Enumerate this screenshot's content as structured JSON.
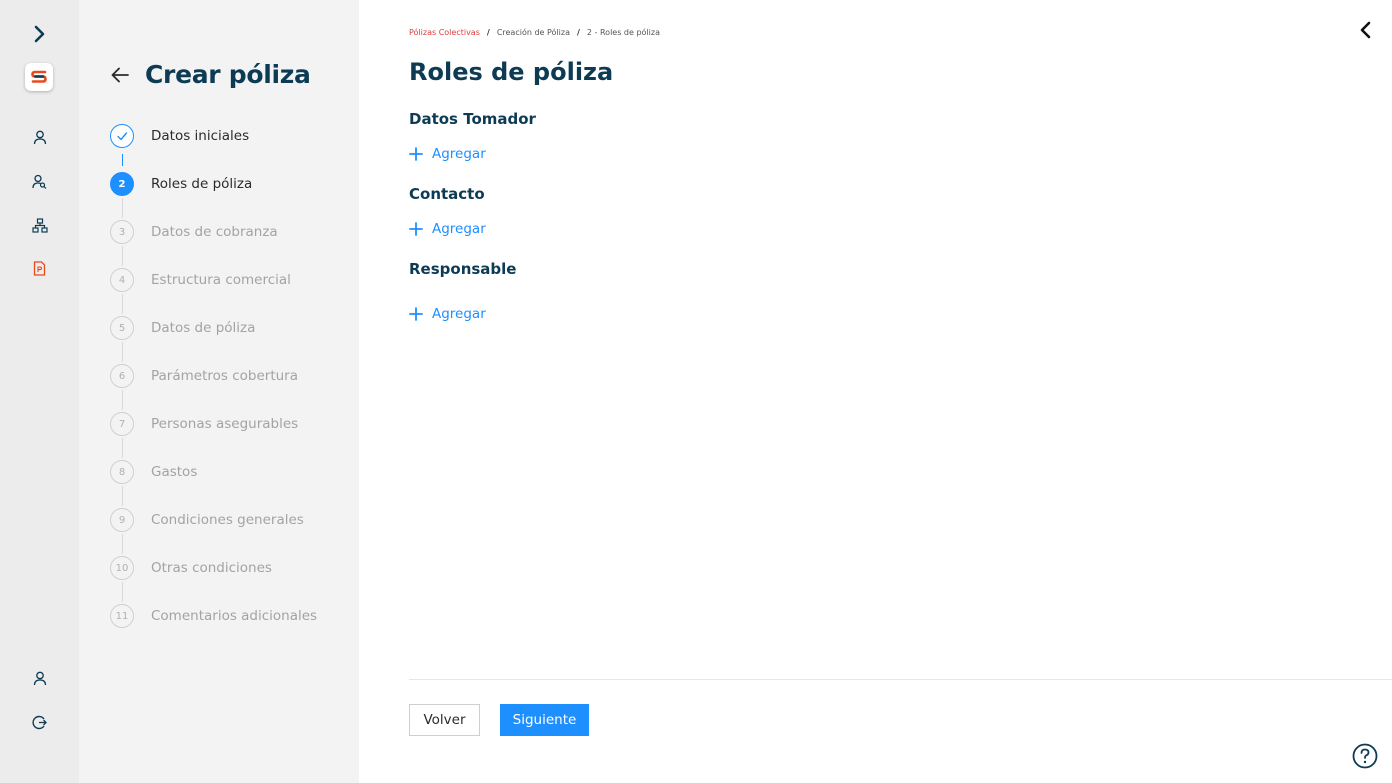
{
  "app": {
    "title": "Crear póliza"
  },
  "colors": {
    "accent": "#1e8fff",
    "brand_dark": "#0d3b54",
    "brand_red": "#e84a1e"
  },
  "rail": {
    "items": [
      {
        "icon": "chevron-right-icon"
      },
      {
        "icon": "logo-icon"
      },
      {
        "icon": "user-icon"
      },
      {
        "icon": "users-search-icon"
      },
      {
        "icon": "hierarchy-icon"
      },
      {
        "icon": "policy-document-icon"
      },
      {
        "icon": "profile-icon"
      },
      {
        "icon": "logout-icon"
      }
    ]
  },
  "steps": {
    "title": "Crear póliza",
    "items": [
      {
        "num": "1",
        "label": "Datos iniciales",
        "state": "done"
      },
      {
        "num": "2",
        "label": "Roles de póliza",
        "state": "active"
      },
      {
        "num": "3",
        "label": "Datos de cobranza",
        "state": "pending"
      },
      {
        "num": "4",
        "label": "Estructura comercial",
        "state": "pending"
      },
      {
        "num": "5",
        "label": "Datos de póliza",
        "state": "pending"
      },
      {
        "num": "6",
        "label": "Parámetros cobertura",
        "state": "pending"
      },
      {
        "num": "7",
        "label": "Personas asegurables",
        "state": "pending"
      },
      {
        "num": "8",
        "label": "Gastos",
        "state": "pending"
      },
      {
        "num": "9",
        "label": "Condiciones generales",
        "state": "pending"
      },
      {
        "num": "10",
        "label": "Otras condiciones",
        "state": "pending"
      },
      {
        "num": "11",
        "label": "Comentarios adicionales",
        "state": "pending"
      }
    ]
  },
  "breadcrumb": [
    "Pólizas Colectivas",
    "Creación de Póliza",
    "2 - Roles de póliza"
  ],
  "main": {
    "title": "Roles de póliza",
    "sections": [
      {
        "title": "Datos Tomador",
        "add_label": "Agregar"
      },
      {
        "title": "Contacto",
        "add_label": "Agregar"
      },
      {
        "title": "Responsable",
        "add_label": "Agregar"
      }
    ]
  },
  "footer": {
    "back_label": "Volver",
    "next_label": "Siguiente"
  }
}
